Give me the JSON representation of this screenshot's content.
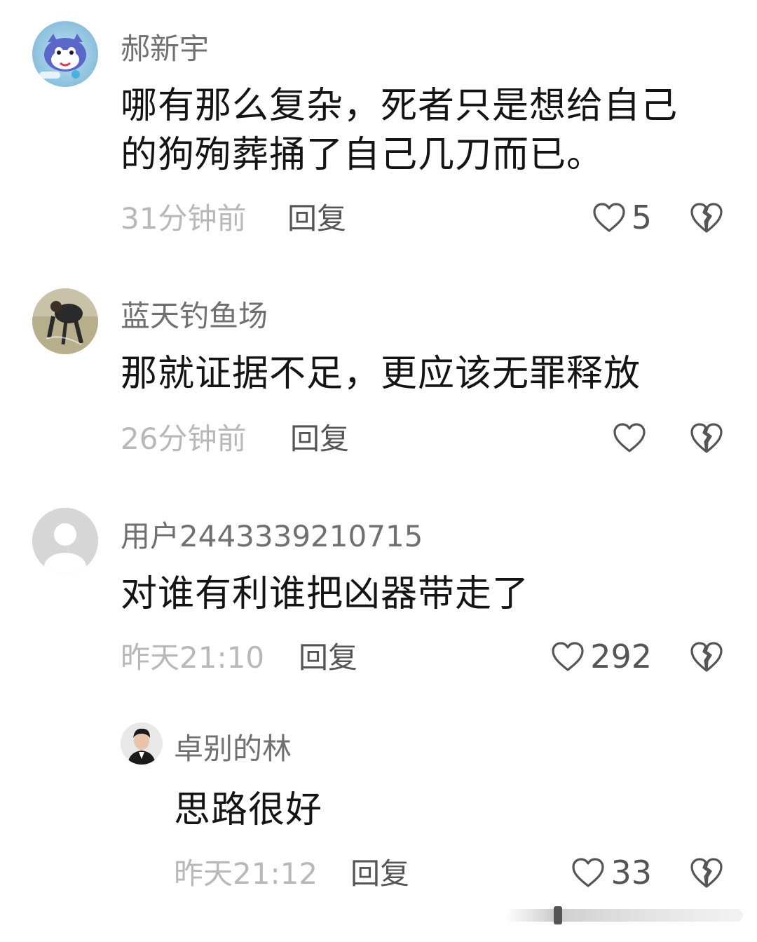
{
  "comments": [
    {
      "username": "郝新宇",
      "content": "哪有那么复杂，死者只是想给自己的狗殉葬捅了自己几刀而已。",
      "time": "31分钟前",
      "reply_label": "回复",
      "likes": "5",
      "avatar_icon": "cartoon-avatar-icon"
    },
    {
      "username": "蓝天钓鱼场",
      "content": "那就证据不足，更应该无罪释放",
      "time": "26分钟前",
      "reply_label": "回复",
      "likes": "",
      "avatar_icon": "photo-avatar-icon"
    },
    {
      "username": "用户2443339210715",
      "content": "对谁有利谁把凶器带走了",
      "time": "昨天21:10",
      "reply_label": "回复",
      "likes": "292",
      "avatar_icon": "default-user-avatar-icon"
    }
  ],
  "reply": {
    "username": "卓别的林",
    "content": "思路很好",
    "time": "昨天21:12",
    "reply_label": "回复",
    "likes": "33",
    "avatar_icon": "portrait-avatar-icon"
  },
  "colors": {
    "username": "#707070",
    "content": "#141414",
    "time": "#b8b8b8",
    "action": "#555555"
  }
}
